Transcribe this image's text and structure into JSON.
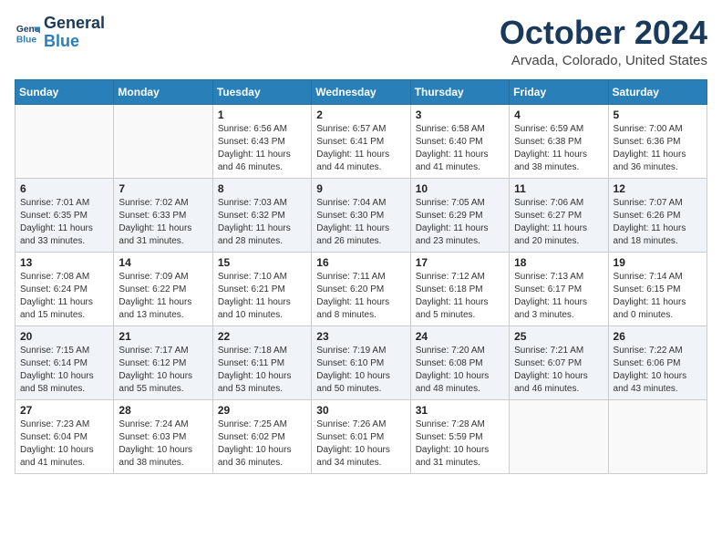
{
  "header": {
    "logo_line1": "General",
    "logo_line2": "Blue",
    "month": "October 2024",
    "location": "Arvada, Colorado, United States"
  },
  "weekdays": [
    "Sunday",
    "Monday",
    "Tuesday",
    "Wednesday",
    "Thursday",
    "Friday",
    "Saturday"
  ],
  "weeks": [
    [
      {
        "day": "",
        "sunrise": "",
        "sunset": "",
        "daylight": ""
      },
      {
        "day": "",
        "sunrise": "",
        "sunset": "",
        "daylight": ""
      },
      {
        "day": "1",
        "sunrise": "Sunrise: 6:56 AM",
        "sunset": "Sunset: 6:43 PM",
        "daylight": "Daylight: 11 hours and 46 minutes."
      },
      {
        "day": "2",
        "sunrise": "Sunrise: 6:57 AM",
        "sunset": "Sunset: 6:41 PM",
        "daylight": "Daylight: 11 hours and 44 minutes."
      },
      {
        "day": "3",
        "sunrise": "Sunrise: 6:58 AM",
        "sunset": "Sunset: 6:40 PM",
        "daylight": "Daylight: 11 hours and 41 minutes."
      },
      {
        "day": "4",
        "sunrise": "Sunrise: 6:59 AM",
        "sunset": "Sunset: 6:38 PM",
        "daylight": "Daylight: 11 hours and 38 minutes."
      },
      {
        "day": "5",
        "sunrise": "Sunrise: 7:00 AM",
        "sunset": "Sunset: 6:36 PM",
        "daylight": "Daylight: 11 hours and 36 minutes."
      }
    ],
    [
      {
        "day": "6",
        "sunrise": "Sunrise: 7:01 AM",
        "sunset": "Sunset: 6:35 PM",
        "daylight": "Daylight: 11 hours and 33 minutes."
      },
      {
        "day": "7",
        "sunrise": "Sunrise: 7:02 AM",
        "sunset": "Sunset: 6:33 PM",
        "daylight": "Daylight: 11 hours and 31 minutes."
      },
      {
        "day": "8",
        "sunrise": "Sunrise: 7:03 AM",
        "sunset": "Sunset: 6:32 PM",
        "daylight": "Daylight: 11 hours and 28 minutes."
      },
      {
        "day": "9",
        "sunrise": "Sunrise: 7:04 AM",
        "sunset": "Sunset: 6:30 PM",
        "daylight": "Daylight: 11 hours and 26 minutes."
      },
      {
        "day": "10",
        "sunrise": "Sunrise: 7:05 AM",
        "sunset": "Sunset: 6:29 PM",
        "daylight": "Daylight: 11 hours and 23 minutes."
      },
      {
        "day": "11",
        "sunrise": "Sunrise: 7:06 AM",
        "sunset": "Sunset: 6:27 PM",
        "daylight": "Daylight: 11 hours and 20 minutes."
      },
      {
        "day": "12",
        "sunrise": "Sunrise: 7:07 AM",
        "sunset": "Sunset: 6:26 PM",
        "daylight": "Daylight: 11 hours and 18 minutes."
      }
    ],
    [
      {
        "day": "13",
        "sunrise": "Sunrise: 7:08 AM",
        "sunset": "Sunset: 6:24 PM",
        "daylight": "Daylight: 11 hours and 15 minutes."
      },
      {
        "day": "14",
        "sunrise": "Sunrise: 7:09 AM",
        "sunset": "Sunset: 6:22 PM",
        "daylight": "Daylight: 11 hours and 13 minutes."
      },
      {
        "day": "15",
        "sunrise": "Sunrise: 7:10 AM",
        "sunset": "Sunset: 6:21 PM",
        "daylight": "Daylight: 11 hours and 10 minutes."
      },
      {
        "day": "16",
        "sunrise": "Sunrise: 7:11 AM",
        "sunset": "Sunset: 6:20 PM",
        "daylight": "Daylight: 11 hours and 8 minutes."
      },
      {
        "day": "17",
        "sunrise": "Sunrise: 7:12 AM",
        "sunset": "Sunset: 6:18 PM",
        "daylight": "Daylight: 11 hours and 5 minutes."
      },
      {
        "day": "18",
        "sunrise": "Sunrise: 7:13 AM",
        "sunset": "Sunset: 6:17 PM",
        "daylight": "Daylight: 11 hours and 3 minutes."
      },
      {
        "day": "19",
        "sunrise": "Sunrise: 7:14 AM",
        "sunset": "Sunset: 6:15 PM",
        "daylight": "Daylight: 11 hours and 0 minutes."
      }
    ],
    [
      {
        "day": "20",
        "sunrise": "Sunrise: 7:15 AM",
        "sunset": "Sunset: 6:14 PM",
        "daylight": "Daylight: 10 hours and 58 minutes."
      },
      {
        "day": "21",
        "sunrise": "Sunrise: 7:17 AM",
        "sunset": "Sunset: 6:12 PM",
        "daylight": "Daylight: 10 hours and 55 minutes."
      },
      {
        "day": "22",
        "sunrise": "Sunrise: 7:18 AM",
        "sunset": "Sunset: 6:11 PM",
        "daylight": "Daylight: 10 hours and 53 minutes."
      },
      {
        "day": "23",
        "sunrise": "Sunrise: 7:19 AM",
        "sunset": "Sunset: 6:10 PM",
        "daylight": "Daylight: 10 hours and 50 minutes."
      },
      {
        "day": "24",
        "sunrise": "Sunrise: 7:20 AM",
        "sunset": "Sunset: 6:08 PM",
        "daylight": "Daylight: 10 hours and 48 minutes."
      },
      {
        "day": "25",
        "sunrise": "Sunrise: 7:21 AM",
        "sunset": "Sunset: 6:07 PM",
        "daylight": "Daylight: 10 hours and 46 minutes."
      },
      {
        "day": "26",
        "sunrise": "Sunrise: 7:22 AM",
        "sunset": "Sunset: 6:06 PM",
        "daylight": "Daylight: 10 hours and 43 minutes."
      }
    ],
    [
      {
        "day": "27",
        "sunrise": "Sunrise: 7:23 AM",
        "sunset": "Sunset: 6:04 PM",
        "daylight": "Daylight: 10 hours and 41 minutes."
      },
      {
        "day": "28",
        "sunrise": "Sunrise: 7:24 AM",
        "sunset": "Sunset: 6:03 PM",
        "daylight": "Daylight: 10 hours and 38 minutes."
      },
      {
        "day": "29",
        "sunrise": "Sunrise: 7:25 AM",
        "sunset": "Sunset: 6:02 PM",
        "daylight": "Daylight: 10 hours and 36 minutes."
      },
      {
        "day": "30",
        "sunrise": "Sunrise: 7:26 AM",
        "sunset": "Sunset: 6:01 PM",
        "daylight": "Daylight: 10 hours and 34 minutes."
      },
      {
        "day": "31",
        "sunrise": "Sunrise: 7:28 AM",
        "sunset": "Sunset: 5:59 PM",
        "daylight": "Daylight: 10 hours and 31 minutes."
      },
      {
        "day": "",
        "sunrise": "",
        "sunset": "",
        "daylight": ""
      },
      {
        "day": "",
        "sunrise": "",
        "sunset": "",
        "daylight": ""
      }
    ]
  ]
}
